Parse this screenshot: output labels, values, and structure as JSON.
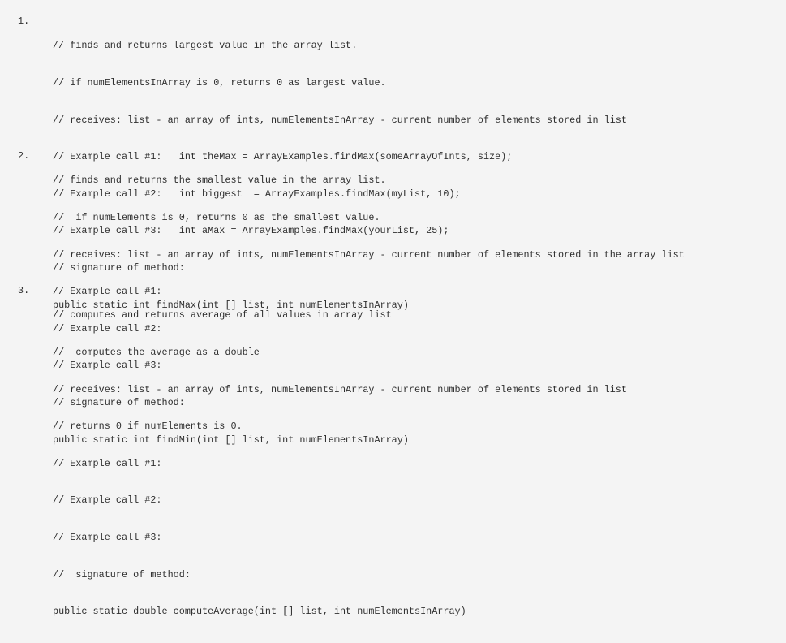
{
  "sections": [
    {
      "number": "1.",
      "lines": [
        "// finds and returns largest value in the array list.",
        "// if numElementsInArray is 0, returns 0 as largest value.",
        "// receives: list - an array of ints, numElementsInArray - current number of elements stored in list",
        "// Example call #1:   int theMax = ArrayExamples.findMax(someArrayOfInts, size);",
        "// Example call #2:   int biggest  = ArrayExamples.findMax(myList, 10);",
        "// Example call #3:   int aMax = ArrayExamples.findMax(yourList, 25);",
        "// signature of method:",
        "public static int findMax(int [] list, int numElementsInArray)"
      ]
    },
    {
      "number": "2.",
      "lines": [
        "// finds and returns the smallest value in the array list.",
        "//  if numElements is 0, returns 0 as the smallest value.",
        "// receives: list - an array of ints, numElementsInArray - current number of elements stored in the array list",
        "// Example call #1:",
        "// Example call #2:",
        "// Example call #3:",
        "// signature of method:",
        "public static int findMin(int [] list, int numElementsInArray)"
      ]
    },
    {
      "number": "3.",
      "lines": [
        "// computes and returns average of all values in array list",
        "//  computes the average as a double",
        "// receives: list - an array of ints, numElementsInArray - current number of elements stored in list",
        "// returns 0 if numElements is 0.",
        "// Example call #1:",
        "// Example call #2:",
        "// Example call #3:",
        "//  signature of method:",
        "public static double computeAverage(int [] list, int numElementsInArray)"
      ]
    }
  ]
}
